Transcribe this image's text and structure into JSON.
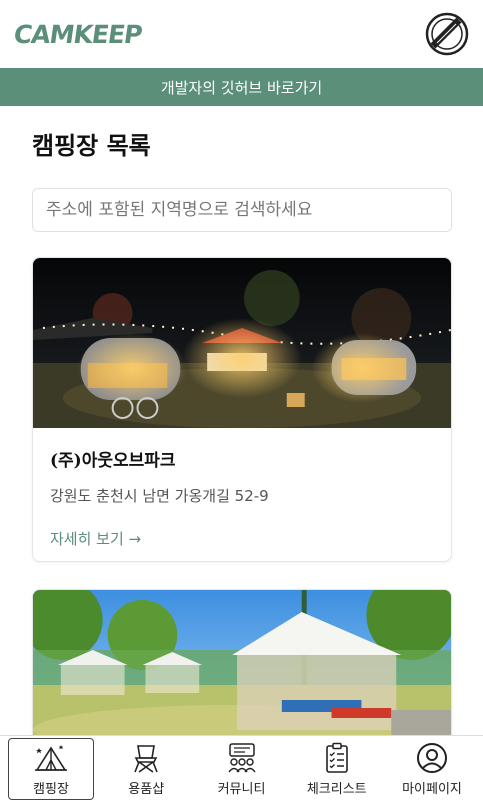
{
  "header": {
    "logo": "CAMKEEP",
    "badge_icon": "newbie-badge-icon"
  },
  "banner": {
    "text": "개발자의 깃허브 바로가기"
  },
  "page": {
    "title": "캠핑장 목록"
  },
  "search": {
    "placeholder": "주소에 포함된 지역명으로 검색하세요"
  },
  "cards": [
    {
      "name": "(주)아웃오브파크",
      "address": "강원도 춘천시 남면 가옹개길 52-9",
      "link": "자세히 보기 →"
    },
    {
      "name": "",
      "address": "",
      "link": ""
    }
  ],
  "tabs": [
    {
      "label": "캠핑장",
      "icon": "tent-icon",
      "active": true
    },
    {
      "label": "용품샵",
      "icon": "camp-chair-icon",
      "active": false
    },
    {
      "label": "커뮤니티",
      "icon": "community-icon",
      "active": false
    },
    {
      "label": "체크리스트",
      "icon": "clipboard-icon",
      "active": false
    },
    {
      "label": "마이페이지",
      "icon": "user-circle-icon",
      "active": false
    }
  ],
  "colors": {
    "accent": "#5b8f7a"
  }
}
